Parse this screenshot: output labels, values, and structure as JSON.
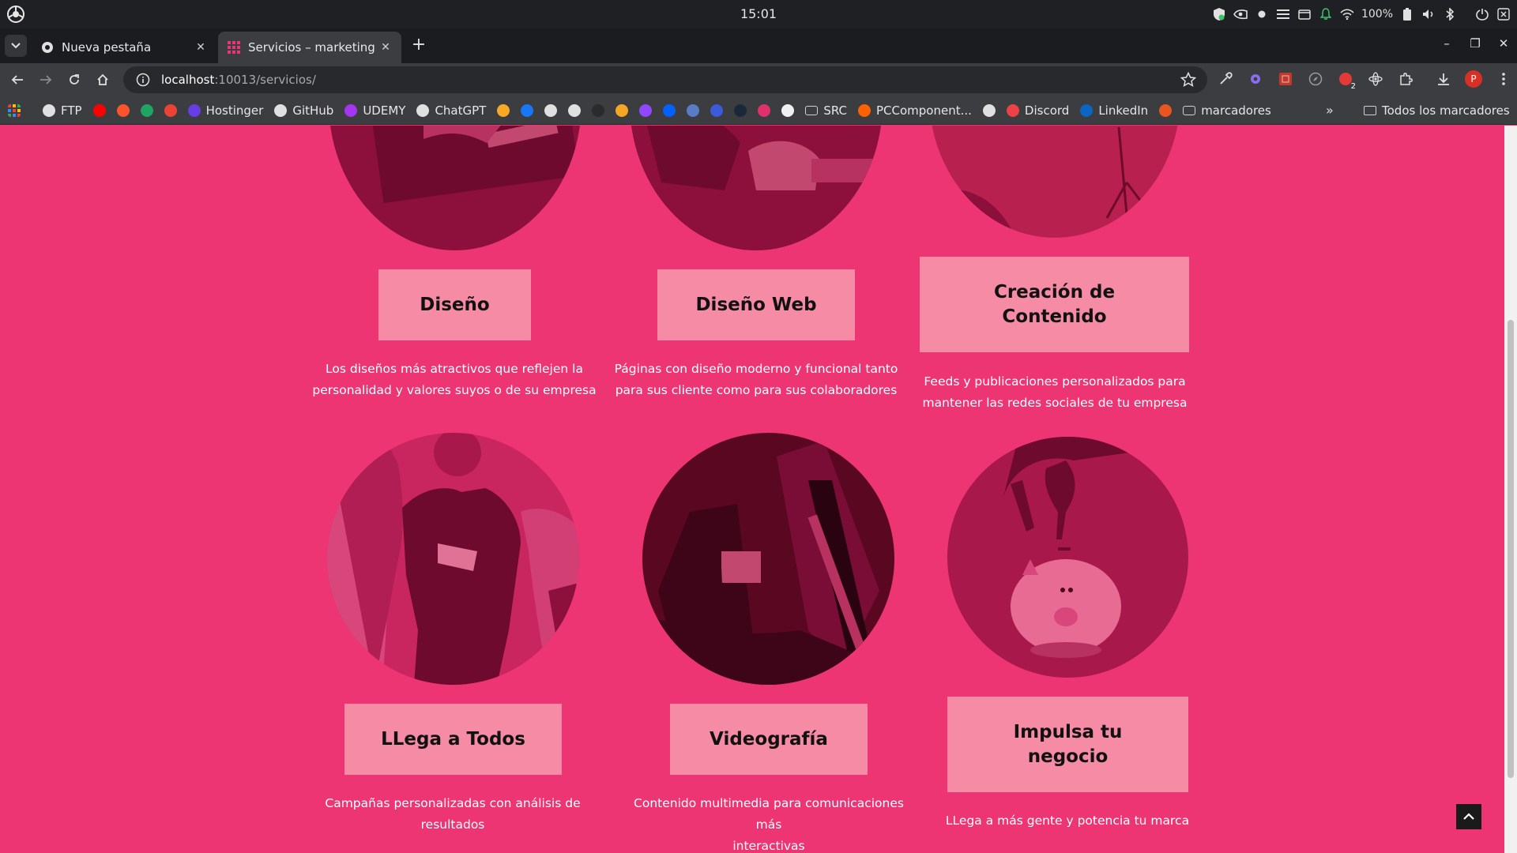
{
  "os": {
    "clock": "15:01",
    "battery": "100%"
  },
  "tabs": [
    {
      "title": "Nueva pestaña",
      "active": false
    },
    {
      "title": "Servicios – marketing a",
      "active": true
    }
  ],
  "toolbar": {
    "url_host": "localhost",
    "url_path": ":10013/servicios/",
    "profile_initial": "P",
    "notif_badge": "2"
  },
  "bookmarks": {
    "items": [
      {
        "label": "FTP",
        "icon": "ftp-icon",
        "color": "#e0e0e0"
      },
      {
        "label": "",
        "icon": "youtube-icon",
        "color": "#ff0000"
      },
      {
        "label": "",
        "icon": "brave-icon",
        "color": "#fb542b"
      },
      {
        "label": "",
        "icon": "drive-icon",
        "color": "#1fa463"
      },
      {
        "label": "",
        "icon": "gmail-icon",
        "color": "#ea4335"
      },
      {
        "label": "Hostinger",
        "icon": "hostinger-icon",
        "color": "#673de6"
      },
      {
        "label": "GitHub",
        "icon": "github-icon",
        "color": "#e0e0e0"
      },
      {
        "label": "UDEMY",
        "icon": "udemy-icon",
        "color": "#a435f0"
      },
      {
        "label": "ChatGPT",
        "icon": "chatgpt-icon",
        "color": "#e0e0e0"
      },
      {
        "label": "",
        "icon": "m-icon",
        "color": "#f9a825"
      },
      {
        "label": "",
        "icon": "facebook-icon",
        "color": "#1877f2"
      },
      {
        "label": "",
        "icon": "threads-icon",
        "color": "#e0e0e0"
      },
      {
        "label": "",
        "icon": "x-icon",
        "color": "#e0e0e0"
      },
      {
        "label": "",
        "icon": "adobe-icon",
        "color": "#2b2b2b"
      },
      {
        "label": "",
        "icon": "coin-icon",
        "color": "#f5a623"
      },
      {
        "label": "",
        "icon": "twitch-icon",
        "color": "#9146ff"
      },
      {
        "label": "",
        "icon": "dropbox-icon",
        "color": "#0061ff"
      },
      {
        "label": "",
        "icon": "wordpress-icon",
        "color": "#5a7cc7"
      },
      {
        "label": "",
        "icon": "u-icon",
        "color": "#3b5bdb"
      },
      {
        "label": "",
        "icon": "steam-icon",
        "color": "#1b2838"
      },
      {
        "label": "",
        "icon": "instagram-icon",
        "color": "#e1306c"
      },
      {
        "label": "",
        "icon": "amazon-icon",
        "color": "#f0f0f0"
      },
      {
        "label": "SRC",
        "icon": "folder-icon",
        "color": "#cfcfcf"
      },
      {
        "label": "PCComponent...",
        "icon": "pccomponentes-icon",
        "color": "#ff6000"
      },
      {
        "label": "",
        "icon": "globe-icon",
        "color": "#e0e0e0"
      },
      {
        "label": "Discord",
        "icon": "discord-icon",
        "color": "#ed4245"
      },
      {
        "label": "LinkedIn",
        "icon": "linkedin-icon",
        "color": "#0a66c2"
      },
      {
        "label": "",
        "icon": "ubuntu-icon",
        "color": "#e95420"
      },
      {
        "label": "marcadores",
        "icon": "folder-icon",
        "color": "#cfcfcf"
      }
    ],
    "all_label": "Todos los marcadores"
  },
  "services": [
    {
      "title": "Diseño",
      "description_line1": "Los diseños más atractivos que reflejen la",
      "description_line2": "personalidad y valores suyos o de su empresa"
    },
    {
      "title": "Diseño Web",
      "description_line1": "Páginas con diseño moderno y funcional tanto",
      "description_line2": "para sus cliente como para sus colaboradores"
    },
    {
      "title_line1": "Creación de",
      "title_line2": "Contenido",
      "description_line1": "Feeds y publicaciones personalizados para",
      "description_line2": "mantener las redes sociales de tu empresa"
    },
    {
      "title": "LLega a Todos",
      "description_line1": "Campañas personalizadas con análisis de",
      "description_line2": "resultados"
    },
    {
      "title": "Videografía",
      "description_line1": "Contenido multimedia para comunicaciones más",
      "description_line2": "interactivas"
    },
    {
      "title_line1": "Impulsa tu",
      "title_line2": "negocio",
      "description_line1": "LLega a más gente y potencia tu marca"
    }
  ],
  "colors": {
    "page_bg": "#ee3573",
    "title_box": "#f68ba5",
    "circle_dark": "#8c0f3c",
    "text_white": "#ffffff"
  }
}
